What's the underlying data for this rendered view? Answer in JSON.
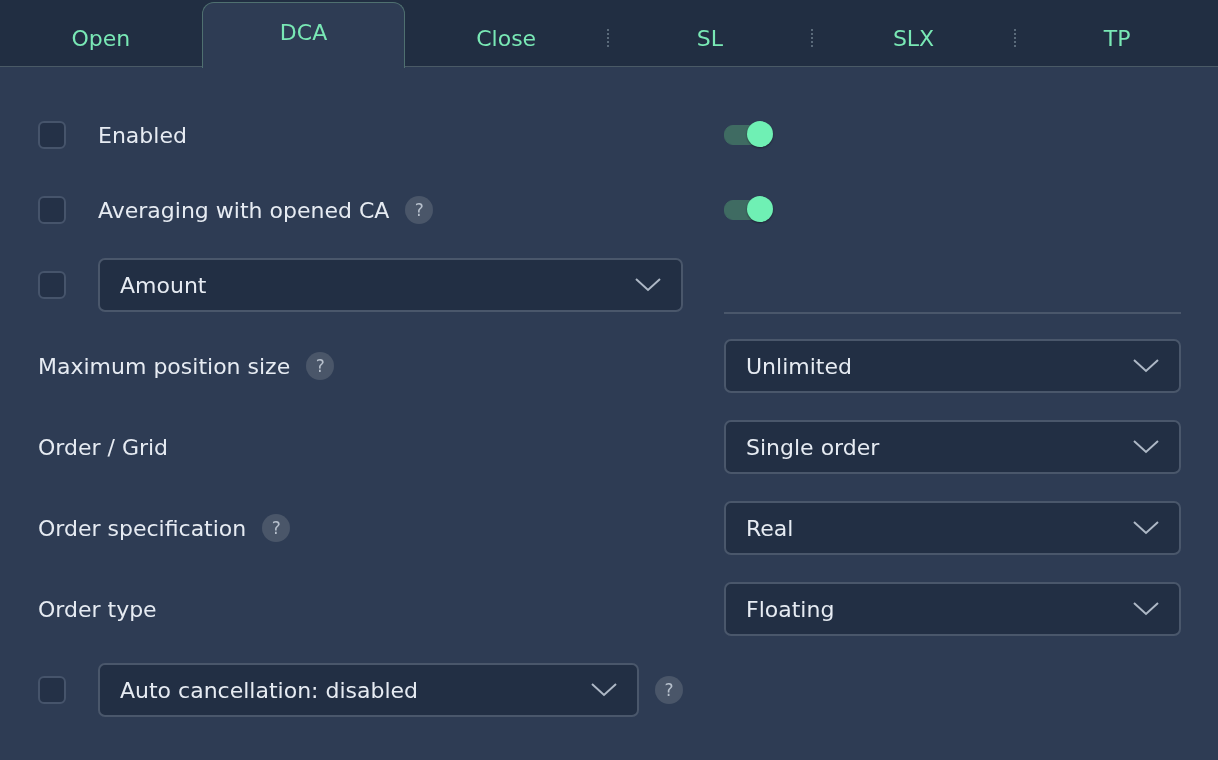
{
  "tabs": [
    {
      "label": "Open",
      "selected": false
    },
    {
      "label": "DCA",
      "selected": true
    },
    {
      "label": "Close",
      "selected": false
    },
    {
      "label": "SL",
      "selected": false
    },
    {
      "label": "SLX",
      "selected": false
    },
    {
      "label": "TP",
      "selected": false
    }
  ],
  "rows": [
    {
      "left": {
        "kind": "checkbox",
        "checked": false,
        "label": "Enabled"
      },
      "right": {
        "kind": "toggle",
        "on": true
      }
    },
    {
      "left": {
        "kind": "checkbox",
        "checked": false,
        "label": "Averaging with opened CA",
        "help": "?"
      },
      "right": {
        "kind": "toggle",
        "on": true
      }
    },
    {
      "left": {
        "kind": "checkbox-select",
        "checked": false,
        "value": "Amount"
      },
      "right": {
        "kind": "divider"
      }
    },
    {
      "left": {
        "kind": "label",
        "label": "Maximum position size",
        "help": "?"
      },
      "right": {
        "kind": "select",
        "value": "Unlimited"
      }
    },
    {
      "left": {
        "kind": "label",
        "label": "Order / Grid"
      },
      "right": {
        "kind": "select",
        "value": "Single order"
      }
    },
    {
      "left": {
        "kind": "label",
        "label": "Order specification",
        "help": "?"
      },
      "right": {
        "kind": "select",
        "value": "Real"
      }
    },
    {
      "left": {
        "kind": "label",
        "label": "Order type"
      },
      "right": {
        "kind": "select",
        "value": "Floating"
      }
    },
    {
      "left": {
        "kind": "checkbox-select",
        "checked": false,
        "value": "Auto cancellation: disabled",
        "help": "?"
      }
    }
  ]
}
